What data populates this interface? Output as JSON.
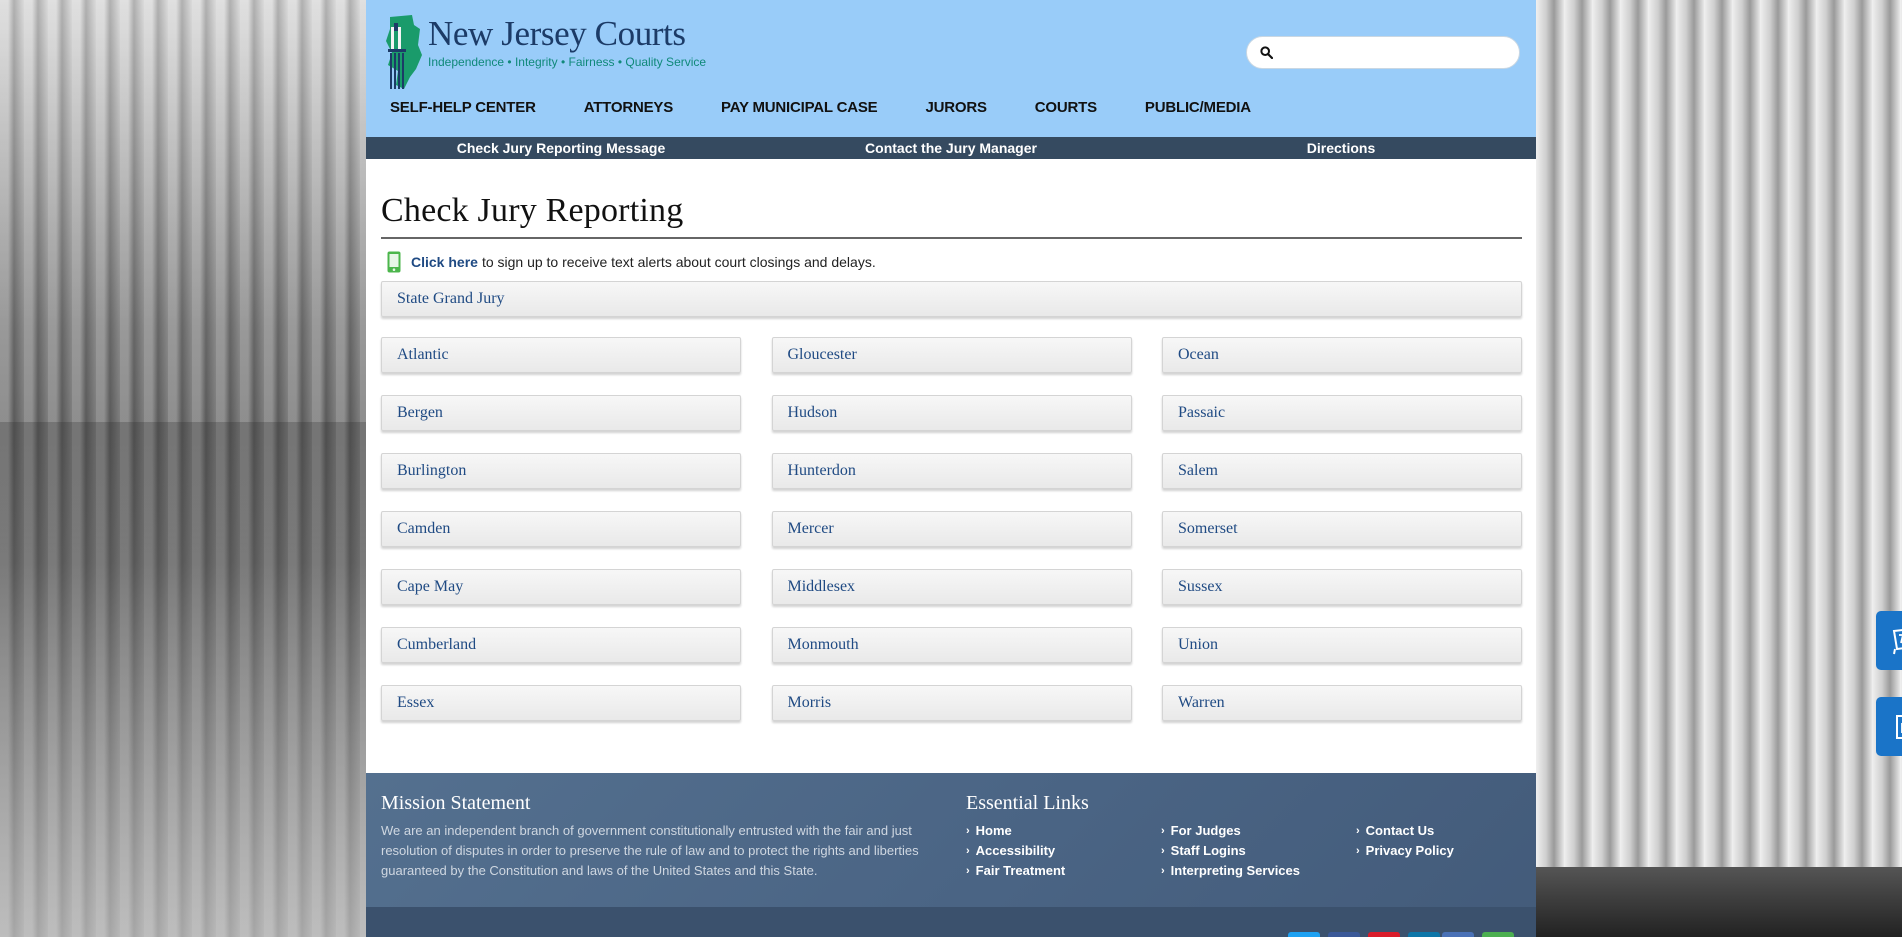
{
  "header": {
    "logo_title": "New Jersey Courts",
    "logo_tagline": "Independence • Integrity • Fairness • Quality Service",
    "search_placeholder": ""
  },
  "nav": {
    "items": [
      {
        "label": "SELF-HELP CENTER"
      },
      {
        "label": "ATTORNEYS"
      },
      {
        "label": "PAY MUNICIPAL CASE"
      },
      {
        "label": "JURORS"
      },
      {
        "label": "COURTS"
      },
      {
        "label": "PUBLIC/MEDIA"
      }
    ]
  },
  "subnav": {
    "items": [
      {
        "label": "Check Jury Reporting Message"
      },
      {
        "label": "Contact the Jury Manager"
      },
      {
        "label": "Directions"
      }
    ]
  },
  "main": {
    "title": "Check Jury Reporting",
    "alert_link": "Click here",
    "alert_text": "to sign up to receive text alerts about court closings and delays.",
    "grand_jury": "State Grand Jury",
    "counties": [
      [
        "Atlantic",
        "Gloucester",
        "Ocean"
      ],
      [
        "Bergen",
        "Hudson",
        "Passaic"
      ],
      [
        "Burlington",
        "Hunterdon",
        "Salem"
      ],
      [
        "Camden",
        "Mercer",
        "Somerset"
      ],
      [
        "Cape May",
        "Middlesex",
        "Sussex"
      ],
      [
        "Cumberland",
        "Monmouth",
        "Union"
      ],
      [
        "Essex",
        "Morris",
        "Warren"
      ]
    ]
  },
  "footer": {
    "mission_heading": "Mission Statement",
    "mission_text": "We are an independent branch of government constitutionally entrusted with the fair and just resolution of disputes in order to preserve the rule of law and to protect the rights and liberties guaranteed by the Constitution and laws of the United States and this State.",
    "links_heading": "Essential Links",
    "links": [
      [
        "Home",
        "For Judges",
        "Contact Us"
      ],
      [
        "Accessibility",
        "Staff Logins",
        "Privacy Policy"
      ],
      [
        "Fair Treatment",
        "Interpreting Services",
        ""
      ]
    ],
    "social_colors": [
      "#1ea1f2",
      "#3b5998",
      "#d91c2a",
      "#0e76a8",
      "#4a71b6",
      "#4caf50"
    ]
  },
  "widgets": {
    "translate_icon": "translate-flag-icon",
    "accessibility_icon": "document-accessibility-icon"
  },
  "colors": {
    "header_bg": "#99ccf9",
    "subnav_bg": "#354a60",
    "link": "#1f4a83",
    "footer_bg": "#4a6484",
    "widget_bg": "#1a74c8"
  }
}
